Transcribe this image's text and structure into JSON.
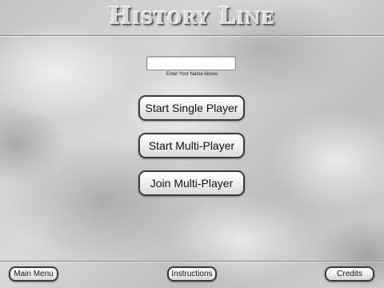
{
  "header": {
    "title": "History Line"
  },
  "name_entry": {
    "value": "",
    "placeholder": "",
    "hint": "Enter Your Name Above"
  },
  "menu": {
    "single_player": "Start Single Player",
    "start_multi": "Start Multi-Player",
    "join_multi": "Join Multi-Player"
  },
  "footer": {
    "main_menu": "Main Menu",
    "instructions": "Instructions",
    "credits": "Credits"
  }
}
